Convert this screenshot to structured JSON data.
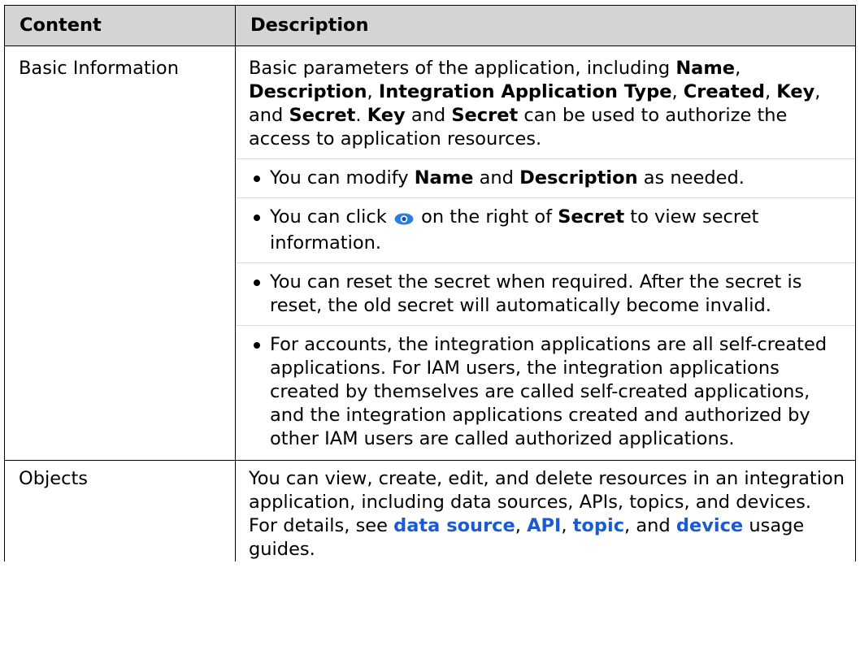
{
  "table": {
    "headers": [
      "Content",
      "Description"
    ],
    "rows": [
      {
        "content": "Basic Information",
        "intro": {
          "t1": "Basic parameters of the application, including ",
          "b1": "Name",
          "t2": ", ",
          "b2": "Description",
          "t3": ", ",
          "b3": "Integration Application Type",
          "t4": ", ",
          "b4": "Created",
          "t5": ", ",
          "b5": "Key",
          "t6": ", and ",
          "b6": "Secret",
          "t7": ". ",
          "b7": "Key",
          "t8": " and ",
          "b8": "Secret",
          "t9": " can be used to authorize the access to application resources."
        },
        "bullets": [
          {
            "t1": "You can modify ",
            "b1": "Name",
            "t2": " and ",
            "b2": "Description",
            "t3": " as needed."
          },
          {
            "t1": "You can click ",
            "icon": "eye-icon",
            "t2": " on the right of ",
            "b1": "Secret",
            "t3": " to view secret information."
          },
          {
            "text": "You can reset the secret when required. After the secret is reset, the old secret will automatically become invalid."
          },
          {
            "text": "For accounts, the integration applications are all self-created applications. For IAM users, the integration applications created by themselves are called self-created applications, and the integration applications created and authorized by other IAM users are called authorized applications."
          }
        ]
      },
      {
        "content": "Objects",
        "desc": {
          "t1": "You can view, create, edit, and delete resources in an integration application, including data sources, APIs, topics, and devices. For details, see ",
          "l1": "data source",
          "t2": ", ",
          "l2": "API",
          "t3": ", ",
          "l3": "topic",
          "t4": ", and ",
          "l4": "device",
          "t5": " usage guides."
        }
      }
    ]
  },
  "colors": {
    "header_bg": "#d4d4d4",
    "link": "#1a5cd0",
    "border": "#000000",
    "separator": "#d9d9d9"
  }
}
